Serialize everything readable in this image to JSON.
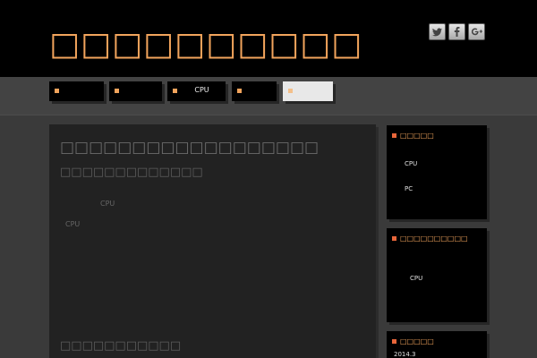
{
  "header": {
    "site_title": "□□□□□□□□□□",
    "social": [
      {
        "name": "twitter",
        "icon": "twitter-icon"
      },
      {
        "name": "facebook",
        "icon": "facebook-icon"
      },
      {
        "name": "google-plus",
        "icon": "google-plus-icon"
      }
    ]
  },
  "nav": {
    "items": [
      {
        "label": ""
      },
      {
        "label": ""
      },
      {
        "label": "CPU"
      },
      {
        "label": ""
      },
      {
        "label": "",
        "active": true
      }
    ]
  },
  "main": {
    "post_title": "□□□□□□□□□□□□□□□□□□",
    "post_subtitle": "□□□□□□□□□□□□□",
    "text_1": "CPU",
    "text_2": "CPU",
    "heading_2": "□□□□□□□□□□□"
  },
  "sidebar": {
    "widget1": {
      "title": "□□□□□",
      "items": [
        "CPU",
        "PC"
      ]
    },
    "widget2": {
      "title": "□□□□□□□□□□",
      "items": [
        "CPU"
      ]
    },
    "widget3": {
      "title": "□□□□□",
      "items": [
        "2014.3"
      ]
    }
  },
  "colors": {
    "accent": "#f2a45c",
    "marker": "#e8663a",
    "background": "#3a3a3a",
    "panel": "#222222"
  }
}
